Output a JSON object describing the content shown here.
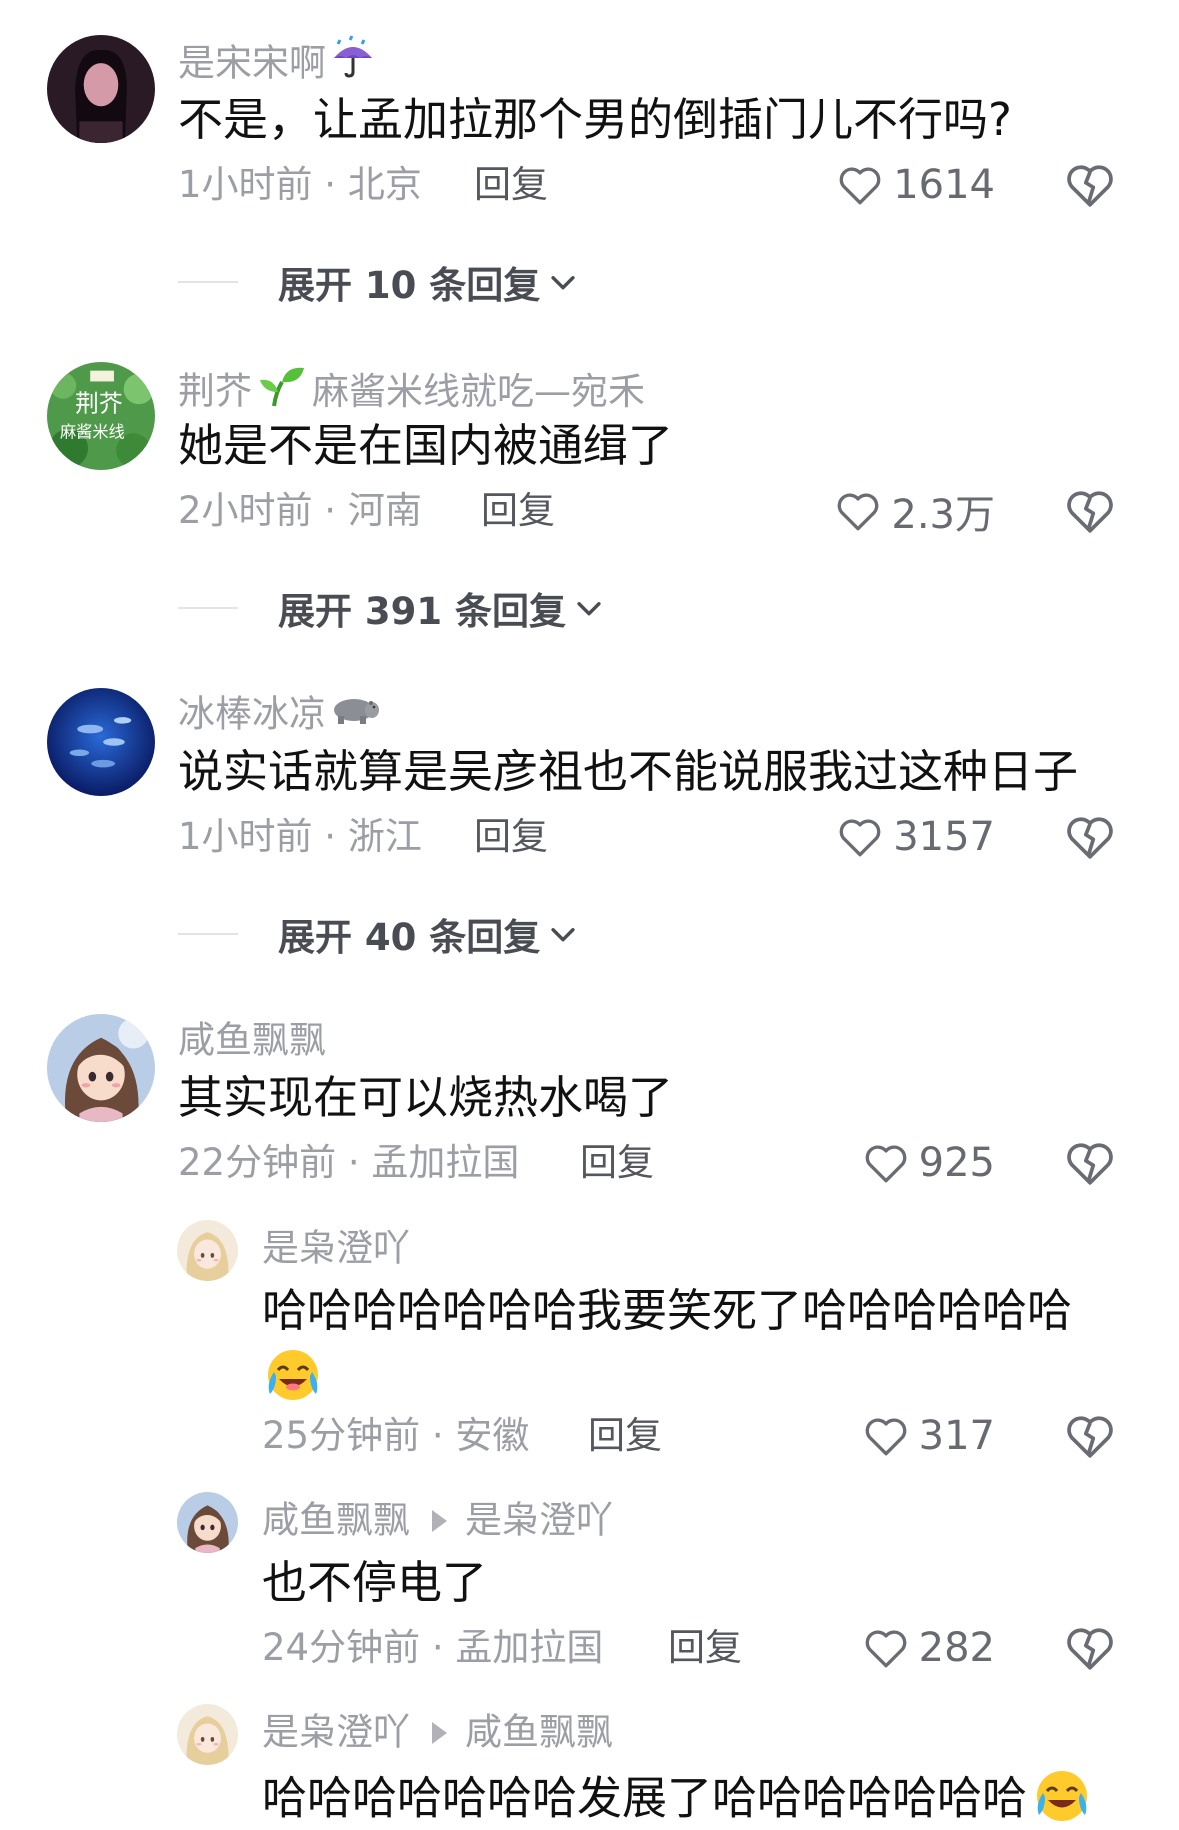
{
  "colors": {
    "background": "#ffffff",
    "text_primary": "#111111",
    "text_meta": "#9c9ea5",
    "reply": "#55575e",
    "icon": "#6a6c74"
  },
  "comments": [
    {
      "username": "是宋宋啊",
      "username_emoji": "umbrella-with-rain-icon",
      "text": "不是，让孟加拉那个男的倒插门儿不行吗?",
      "meta": "1小时前 · 北京",
      "reply_label": "回复",
      "likes": "1614",
      "expand_label": "展开 10 条回复"
    },
    {
      "username": "荆芥",
      "username_emoji": "seedling-icon",
      "username_suffix": "麻酱米线就吃—宛禾",
      "avatar_text": [
        "荆芥",
        "麻酱米线"
      ],
      "text": "她是不是在国内被通缉了",
      "meta": "2小时前 · 河南",
      "reply_label": "回复",
      "likes": "2.3万",
      "expand_label": "展开 391 条回复"
    },
    {
      "username": "冰棒冰凉",
      "username_emoji": "hippo-icon",
      "text": "说实话就算是吴彦祖也不能说服我过这种日子",
      "meta": "1小时前 · 浙江",
      "reply_label": "回复",
      "likes": "3157",
      "expand_label": "展开 40 条回复"
    },
    {
      "username": "咸鱼飘飘",
      "text": "其实现在可以烧热水喝了",
      "meta": "22分钟前 · 孟加拉国",
      "reply_label": "回复",
      "likes": "925"
    }
  ],
  "replies": [
    {
      "username": "是枭澄吖",
      "text": "哈哈哈哈哈哈哈我要笑死了哈哈哈哈哈哈",
      "text_emoji": "loudly-crying-laughing-icon",
      "meta": "25分钟前 · 安徽",
      "reply_label": "回复",
      "likes": "317"
    },
    {
      "username": "咸鱼飘飘",
      "reply_to": "是枭澄吖",
      "text": "也不停电了",
      "meta": "24分钟前 · 孟加拉国",
      "reply_label": "回复",
      "likes": "282"
    },
    {
      "username": "是枭澄吖",
      "reply_to": "咸鱼飘飘",
      "text": "哈哈哈哈哈哈哈发展了哈哈哈哈哈哈哈",
      "text_emoji": "loudly-crying-laughing-icon"
    }
  ]
}
